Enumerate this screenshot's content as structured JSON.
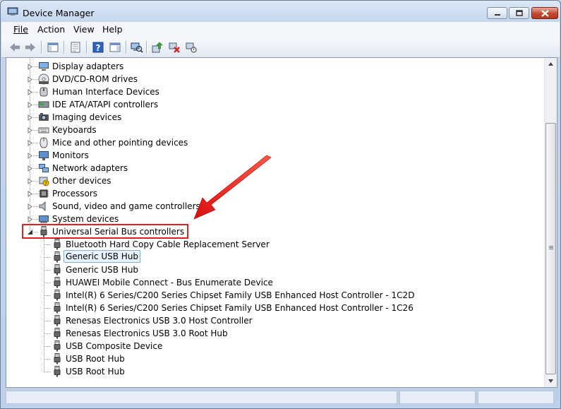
{
  "window": {
    "title": "Device Manager",
    "accent": "#dce8f6",
    "close_color": "#c24a31"
  },
  "menu": {
    "file": "File",
    "action": "Action",
    "view": "View",
    "help": "Help"
  },
  "toolbar": {
    "buttons": [
      "back-icon",
      "forward-icon",
      "show-hide-console-tree-icon",
      "properties-icon",
      "help-icon",
      "show-action-pane-icon",
      "scan-hardware-icon",
      "update-driver-icon",
      "uninstall-icon",
      "disable-icon"
    ]
  },
  "tree": {
    "categories": [
      "Display adapters",
      "DVD/CD-ROM drives",
      "Human Interface Devices",
      "IDE ATA/ATAPI controllers",
      "Imaging devices",
      "Keyboards",
      "Mice and other pointing devices",
      "Monitors",
      "Network adapters",
      "Other devices",
      "Processors",
      "Sound, video and game controllers",
      "System devices"
    ],
    "expanded_category": "Universal Serial Bus controllers",
    "children": [
      "Bluetooth Hard Copy Cable Replacement Server",
      "Generic USB Hub",
      "Generic USB Hub",
      "HUAWEI Mobile Connect - Bus Enumerate Device",
      "Intel(R) 6 Series/C200 Series Chipset Family USB Enhanced Host Controller - 1C2D",
      "Intel(R) 6 Series/C200 Series Chipset Family USB Enhanced Host Controller - 1C26",
      "Renesas Electronics USB 3.0 Host Controller",
      "Renesas Electronics USB 3.0 Root Hub",
      "USB Composite Device",
      "USB Root Hub",
      "USB Root Hub"
    ],
    "selected_child": "Generic USB Hub"
  },
  "annotation": {
    "color": "#e02020"
  }
}
